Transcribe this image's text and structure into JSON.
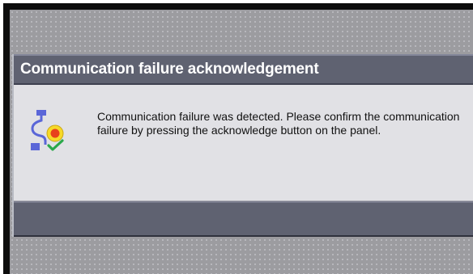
{
  "dialog": {
    "title": "Communication failure acknowledgement",
    "icon": "communication-failure-icon",
    "message": "Communication failure was detected. Please confirm the communication failure by pressing the acknowledge button on the panel."
  },
  "colors": {
    "header_background": "#5f6271",
    "body_background": "#e1e1e5",
    "panel_background": "#9c9ca0",
    "accent_blue": "#5a66d8",
    "alarm_yellow": "#f7d928",
    "alarm_red": "#e8401c",
    "confirm_green": "#2aa84a"
  }
}
